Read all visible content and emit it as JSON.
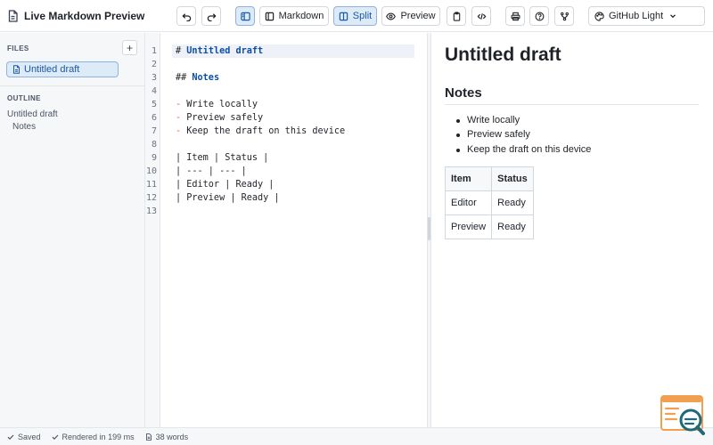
{
  "app": {
    "title": "Live Markdown Preview"
  },
  "toolbar": {
    "markdown_label": "Markdown",
    "split_label": "Split",
    "preview_label": "Preview",
    "theme_value": "GitHub Light"
  },
  "sidebar": {
    "files_heading": "FILES",
    "add_label": "+",
    "files": [
      {
        "label": "Untitled draft"
      }
    ],
    "outline_heading": "OUTLINE",
    "outline": [
      {
        "label": "Untitled draft"
      },
      {
        "label": "Notes"
      }
    ]
  },
  "editor": {
    "line_numbers": [
      "1",
      "2",
      "3",
      "4",
      "5",
      "6",
      "7",
      "8",
      "9",
      "10",
      "11",
      "12",
      "13"
    ],
    "lines": [
      {
        "mark": "# ",
        "text": "Untitled draft",
        "kind": "h1"
      },
      {
        "text": "",
        "kind": "blank"
      },
      {
        "mark": "## ",
        "text": "Notes",
        "kind": "h2"
      },
      {
        "text": "",
        "kind": "blank"
      },
      {
        "mark": "- ",
        "text": "Write locally",
        "kind": "bullet"
      },
      {
        "mark": "- ",
        "text": "Preview safely",
        "kind": "bullet"
      },
      {
        "mark": "- ",
        "text": "Keep the draft on this device",
        "kind": "bullet"
      },
      {
        "text": "",
        "kind": "blank"
      },
      {
        "text": "| Item | Status |",
        "kind": "plain"
      },
      {
        "text": "| --- | --- |",
        "kind": "plain"
      },
      {
        "text": "| Editor | Ready |",
        "kind": "plain"
      },
      {
        "text": "| Preview | Ready |",
        "kind": "plain"
      },
      {
        "text": "",
        "kind": "blank"
      }
    ]
  },
  "preview": {
    "h1": "Untitled draft",
    "h2": "Notes",
    "bullets": [
      "Write locally",
      "Preview safely",
      "Keep the draft on this device"
    ],
    "table": {
      "headers": [
        "Item",
        "Status"
      ],
      "rows": [
        [
          "Editor",
          "Ready"
        ],
        [
          "Preview",
          "Ready"
        ]
      ]
    }
  },
  "status": {
    "saved": "Saved",
    "rendered": "Rendered in 199 ms",
    "words": "38 words"
  },
  "colors": {
    "accent": "#1a5aa6",
    "accent_bg": "#ddeaf8",
    "heading_code": "#0b4ea2",
    "bullet_code": "#cf6b2c",
    "logo_orange": "#f0a050",
    "logo_teal": "#1e6a78"
  },
  "icons": {
    "app": "document-icon",
    "undo": "undo-icon",
    "redo": "redo-icon",
    "sidebar_toggle": "sidebar-toggle-icon",
    "markdown": "editor-pane-icon",
    "split": "split-view-icon",
    "preview": "eye-icon",
    "copy": "clipboard-icon",
    "html": "code-icon",
    "print": "printer-icon",
    "help": "help-icon",
    "share": "share-icon",
    "theme": "palette-icon",
    "chevron": "chevron-down-icon"
  }
}
